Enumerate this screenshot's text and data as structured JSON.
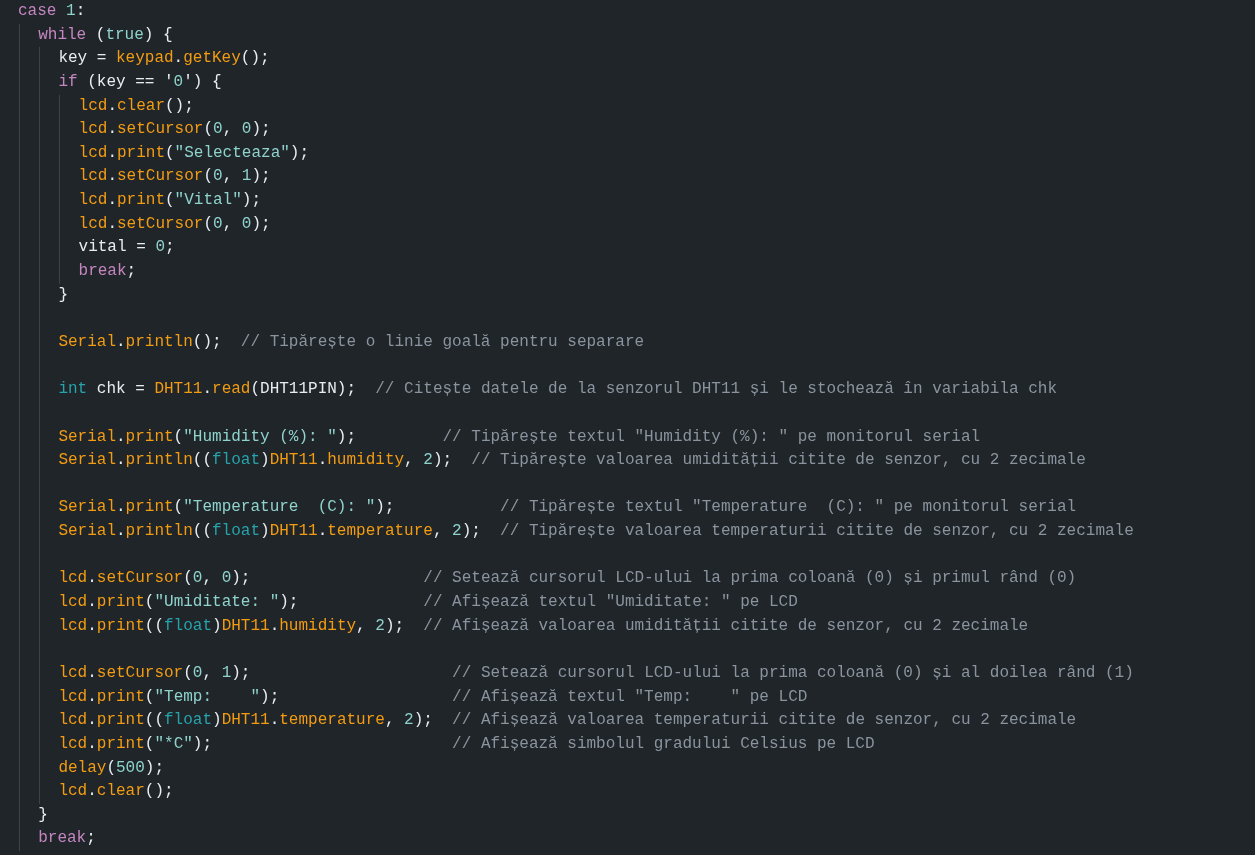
{
  "editor": {
    "lines": [
      {
        "kind": "code",
        "tokens": [
          {
            "text": "case ",
            "kind": "kw"
          },
          {
            "text": "1",
            "kind": "num"
          },
          {
            "text": ":",
            "kind": "plain"
          }
        ],
        "children": [
          {
            "kind": "code",
            "tokens": [
              {
                "text": "while ",
                "kind": "kw"
              },
              {
                "text": "(",
                "kind": "plain"
              },
              {
                "text": "true",
                "kind": "num"
              },
              {
                "text": ") {",
                "kind": "plain"
              }
            ],
            "children": [
              {
                "kind": "code",
                "tokens": [
                  {
                    "text": "key = ",
                    "kind": "plain"
                  },
                  {
                    "text": "keypad",
                    "kind": "fn"
                  },
                  {
                    "text": ".",
                    "kind": "plain"
                  },
                  {
                    "text": "getKey",
                    "kind": "fn"
                  },
                  {
                    "text": "();",
                    "kind": "plain"
                  }
                ]
              },
              {
                "kind": "code",
                "tokens": [
                  {
                    "text": "if ",
                    "kind": "kw"
                  },
                  {
                    "text": "(key == '",
                    "kind": "plain"
                  },
                  {
                    "text": "0",
                    "kind": "num"
                  },
                  {
                    "text": "') {",
                    "kind": "plain"
                  }
                ],
                "children": [
                  {
                    "kind": "code",
                    "tokens": [
                      {
                        "text": "lcd",
                        "kind": "fn"
                      },
                      {
                        "text": ".",
                        "kind": "plain"
                      },
                      {
                        "text": "clear",
                        "kind": "fn"
                      },
                      {
                        "text": "();",
                        "kind": "plain"
                      }
                    ]
                  },
                  {
                    "kind": "code",
                    "tokens": [
                      {
                        "text": "lcd",
                        "kind": "fn"
                      },
                      {
                        "text": ".",
                        "kind": "plain"
                      },
                      {
                        "text": "setCursor",
                        "kind": "fn"
                      },
                      {
                        "text": "(",
                        "kind": "plain"
                      },
                      {
                        "text": "0",
                        "kind": "num"
                      },
                      {
                        "text": ", ",
                        "kind": "plain"
                      },
                      {
                        "text": "0",
                        "kind": "num"
                      },
                      {
                        "text": ");",
                        "kind": "plain"
                      }
                    ]
                  },
                  {
                    "kind": "code",
                    "tokens": [
                      {
                        "text": "lcd",
                        "kind": "fn"
                      },
                      {
                        "text": ".",
                        "kind": "plain"
                      },
                      {
                        "text": "print",
                        "kind": "fn"
                      },
                      {
                        "text": "(",
                        "kind": "plain"
                      },
                      {
                        "text": "\"Selecteaza\"",
                        "kind": "str"
                      },
                      {
                        "text": ");",
                        "kind": "plain"
                      }
                    ]
                  },
                  {
                    "kind": "code",
                    "tokens": [
                      {
                        "text": "lcd",
                        "kind": "fn"
                      },
                      {
                        "text": ".",
                        "kind": "plain"
                      },
                      {
                        "text": "setCursor",
                        "kind": "fn"
                      },
                      {
                        "text": "(",
                        "kind": "plain"
                      },
                      {
                        "text": "0",
                        "kind": "num"
                      },
                      {
                        "text": ", ",
                        "kind": "plain"
                      },
                      {
                        "text": "1",
                        "kind": "num"
                      },
                      {
                        "text": ");",
                        "kind": "plain"
                      }
                    ]
                  },
                  {
                    "kind": "code",
                    "tokens": [
                      {
                        "text": "lcd",
                        "kind": "fn"
                      },
                      {
                        "text": ".",
                        "kind": "plain"
                      },
                      {
                        "text": "print",
                        "kind": "fn"
                      },
                      {
                        "text": "(",
                        "kind": "plain"
                      },
                      {
                        "text": "\"Vital\"",
                        "kind": "str"
                      },
                      {
                        "text": ");",
                        "kind": "plain"
                      }
                    ]
                  },
                  {
                    "kind": "code",
                    "tokens": [
                      {
                        "text": "lcd",
                        "kind": "fn"
                      },
                      {
                        "text": ".",
                        "kind": "plain"
                      },
                      {
                        "text": "setCursor",
                        "kind": "fn"
                      },
                      {
                        "text": "(",
                        "kind": "plain"
                      },
                      {
                        "text": "0",
                        "kind": "num"
                      },
                      {
                        "text": ", ",
                        "kind": "plain"
                      },
                      {
                        "text": "0",
                        "kind": "num"
                      },
                      {
                        "text": ");",
                        "kind": "plain"
                      }
                    ]
                  },
                  {
                    "kind": "code",
                    "tokens": [
                      {
                        "text": "vital = ",
                        "kind": "plain"
                      },
                      {
                        "text": "0",
                        "kind": "num"
                      },
                      {
                        "text": ";",
                        "kind": "plain"
                      }
                    ]
                  },
                  {
                    "kind": "code",
                    "tokens": [
                      {
                        "text": "break",
                        "kind": "kw"
                      },
                      {
                        "text": ";",
                        "kind": "plain"
                      }
                    ]
                  }
                ]
              },
              {
                "kind": "code",
                "tokens": [
                  {
                    "text": "}",
                    "kind": "plain"
                  }
                ]
              },
              {
                "kind": "blank"
              },
              {
                "kind": "code",
                "tokens": [
                  {
                    "text": "Serial",
                    "kind": "fn"
                  },
                  {
                    "text": ".",
                    "kind": "plain"
                  },
                  {
                    "text": "println",
                    "kind": "fn"
                  },
                  {
                    "text": "();  ",
                    "kind": "plain"
                  },
                  {
                    "text": "// Tipărește o linie goală pentru separare",
                    "kind": "cmt"
                  }
                ]
              },
              {
                "kind": "blank"
              },
              {
                "kind": "code",
                "tokens": [
                  {
                    "text": "int",
                    "kind": "type"
                  },
                  {
                    "text": " chk = ",
                    "kind": "plain"
                  },
                  {
                    "text": "DHT11",
                    "kind": "fn"
                  },
                  {
                    "text": ".",
                    "kind": "plain"
                  },
                  {
                    "text": "read",
                    "kind": "fn"
                  },
                  {
                    "text": "(DHT11PIN);  ",
                    "kind": "plain"
                  },
                  {
                    "text": "// Citește datele de la senzorul DHT11 și le stochează în variabila chk",
                    "kind": "cmt"
                  }
                ]
              },
              {
                "kind": "blank"
              },
              {
                "kind": "code",
                "tokens": [
                  {
                    "text": "Serial",
                    "kind": "fn"
                  },
                  {
                    "text": ".",
                    "kind": "plain"
                  },
                  {
                    "text": "print",
                    "kind": "fn"
                  },
                  {
                    "text": "(",
                    "kind": "plain"
                  },
                  {
                    "text": "\"Humidity (%): \"",
                    "kind": "str"
                  },
                  {
                    "text": ");         ",
                    "kind": "plain"
                  },
                  {
                    "text": "// Tipărește textul \"Humidity (%): \" pe monitorul serial",
                    "kind": "cmt"
                  }
                ]
              },
              {
                "kind": "code",
                "tokens": [
                  {
                    "text": "Serial",
                    "kind": "fn"
                  },
                  {
                    "text": ".",
                    "kind": "plain"
                  },
                  {
                    "text": "println",
                    "kind": "fn"
                  },
                  {
                    "text": "((",
                    "kind": "plain"
                  },
                  {
                    "text": "float",
                    "kind": "type"
                  },
                  {
                    "text": ")",
                    "kind": "plain"
                  },
                  {
                    "text": "DHT11",
                    "kind": "fn"
                  },
                  {
                    "text": ".",
                    "kind": "plain"
                  },
                  {
                    "text": "humidity",
                    "kind": "fn"
                  },
                  {
                    "text": ", ",
                    "kind": "plain"
                  },
                  {
                    "text": "2",
                    "kind": "num"
                  },
                  {
                    "text": ");  ",
                    "kind": "plain"
                  },
                  {
                    "text": "// Tipărește valoarea umidității citite de senzor, cu 2 zecimale",
                    "kind": "cmt"
                  }
                ]
              },
              {
                "kind": "blank"
              },
              {
                "kind": "code",
                "tokens": [
                  {
                    "text": "Serial",
                    "kind": "fn"
                  },
                  {
                    "text": ".",
                    "kind": "plain"
                  },
                  {
                    "text": "print",
                    "kind": "fn"
                  },
                  {
                    "text": "(",
                    "kind": "plain"
                  },
                  {
                    "text": "\"Temperature  (C): \"",
                    "kind": "str"
                  },
                  {
                    "text": ");           ",
                    "kind": "plain"
                  },
                  {
                    "text": "// Tipărește textul \"Temperature  (C): \" pe monitorul serial",
                    "kind": "cmt"
                  }
                ]
              },
              {
                "kind": "code",
                "tokens": [
                  {
                    "text": "Serial",
                    "kind": "fn"
                  },
                  {
                    "text": ".",
                    "kind": "plain"
                  },
                  {
                    "text": "println",
                    "kind": "fn"
                  },
                  {
                    "text": "((",
                    "kind": "plain"
                  },
                  {
                    "text": "float",
                    "kind": "type"
                  },
                  {
                    "text": ")",
                    "kind": "plain"
                  },
                  {
                    "text": "DHT11",
                    "kind": "fn"
                  },
                  {
                    "text": ".",
                    "kind": "plain"
                  },
                  {
                    "text": "temperature",
                    "kind": "fn"
                  },
                  {
                    "text": ", ",
                    "kind": "plain"
                  },
                  {
                    "text": "2",
                    "kind": "num"
                  },
                  {
                    "text": ");  ",
                    "kind": "plain"
                  },
                  {
                    "text": "// Tipărește valoarea temperaturii citite de senzor, cu 2 zecimale",
                    "kind": "cmt"
                  }
                ]
              },
              {
                "kind": "blank"
              },
              {
                "kind": "code",
                "tokens": [
                  {
                    "text": "lcd",
                    "kind": "fn"
                  },
                  {
                    "text": ".",
                    "kind": "plain"
                  },
                  {
                    "text": "setCursor",
                    "kind": "fn"
                  },
                  {
                    "text": "(",
                    "kind": "plain"
                  },
                  {
                    "text": "0",
                    "kind": "num"
                  },
                  {
                    "text": ", ",
                    "kind": "plain"
                  },
                  {
                    "text": "0",
                    "kind": "num"
                  },
                  {
                    "text": ");                  ",
                    "kind": "plain"
                  },
                  {
                    "text": "// Setează cursorul LCD-ului la prima coloană (0) și primul rând (0)",
                    "kind": "cmt"
                  }
                ]
              },
              {
                "kind": "code",
                "tokens": [
                  {
                    "text": "lcd",
                    "kind": "fn"
                  },
                  {
                    "text": ".",
                    "kind": "plain"
                  },
                  {
                    "text": "print",
                    "kind": "fn"
                  },
                  {
                    "text": "(",
                    "kind": "plain"
                  },
                  {
                    "text": "\"Umiditate: \"",
                    "kind": "str"
                  },
                  {
                    "text": ");             ",
                    "kind": "plain"
                  },
                  {
                    "text": "// Afișează textul \"Umiditate: \" pe LCD",
                    "kind": "cmt"
                  }
                ]
              },
              {
                "kind": "code",
                "tokens": [
                  {
                    "text": "lcd",
                    "kind": "fn"
                  },
                  {
                    "text": ".",
                    "kind": "plain"
                  },
                  {
                    "text": "print",
                    "kind": "fn"
                  },
                  {
                    "text": "((",
                    "kind": "plain"
                  },
                  {
                    "text": "float",
                    "kind": "type"
                  },
                  {
                    "text": ")",
                    "kind": "plain"
                  },
                  {
                    "text": "DHT11",
                    "kind": "fn"
                  },
                  {
                    "text": ".",
                    "kind": "plain"
                  },
                  {
                    "text": "humidity",
                    "kind": "fn"
                  },
                  {
                    "text": ", ",
                    "kind": "plain"
                  },
                  {
                    "text": "2",
                    "kind": "num"
                  },
                  {
                    "text": ");  ",
                    "kind": "plain"
                  },
                  {
                    "text": "// Afișează valoarea umidității citite de senzor, cu 2 zecimale",
                    "kind": "cmt"
                  }
                ]
              },
              {
                "kind": "blank"
              },
              {
                "kind": "code",
                "tokens": [
                  {
                    "text": "lcd",
                    "kind": "fn"
                  },
                  {
                    "text": ".",
                    "kind": "plain"
                  },
                  {
                    "text": "setCursor",
                    "kind": "fn"
                  },
                  {
                    "text": "(",
                    "kind": "plain"
                  },
                  {
                    "text": "0",
                    "kind": "num"
                  },
                  {
                    "text": ", ",
                    "kind": "plain"
                  },
                  {
                    "text": "1",
                    "kind": "num"
                  },
                  {
                    "text": ");                     ",
                    "kind": "plain"
                  },
                  {
                    "text": "// Setează cursorul LCD-ului la prima coloană (0) și al doilea rând (1)",
                    "kind": "cmt"
                  }
                ]
              },
              {
                "kind": "code",
                "tokens": [
                  {
                    "text": "lcd",
                    "kind": "fn"
                  },
                  {
                    "text": ".",
                    "kind": "plain"
                  },
                  {
                    "text": "print",
                    "kind": "fn"
                  },
                  {
                    "text": "(",
                    "kind": "plain"
                  },
                  {
                    "text": "\"Temp:    \"",
                    "kind": "str"
                  },
                  {
                    "text": ");                  ",
                    "kind": "plain"
                  },
                  {
                    "text": "// Afișează textul \"Temp:    \" pe LCD",
                    "kind": "cmt"
                  }
                ]
              },
              {
                "kind": "code",
                "tokens": [
                  {
                    "text": "lcd",
                    "kind": "fn"
                  },
                  {
                    "text": ".",
                    "kind": "plain"
                  },
                  {
                    "text": "print",
                    "kind": "fn"
                  },
                  {
                    "text": "((",
                    "kind": "plain"
                  },
                  {
                    "text": "float",
                    "kind": "type"
                  },
                  {
                    "text": ")",
                    "kind": "plain"
                  },
                  {
                    "text": "DHT11",
                    "kind": "fn"
                  },
                  {
                    "text": ".",
                    "kind": "plain"
                  },
                  {
                    "text": "temperature",
                    "kind": "fn"
                  },
                  {
                    "text": ", ",
                    "kind": "plain"
                  },
                  {
                    "text": "2",
                    "kind": "num"
                  },
                  {
                    "text": ");  ",
                    "kind": "plain"
                  },
                  {
                    "text": "// Afișează valoarea temperaturii citite de senzor, cu 2 zecimale",
                    "kind": "cmt"
                  }
                ]
              },
              {
                "kind": "code",
                "tokens": [
                  {
                    "text": "lcd",
                    "kind": "fn"
                  },
                  {
                    "text": ".",
                    "kind": "plain"
                  },
                  {
                    "text": "print",
                    "kind": "fn"
                  },
                  {
                    "text": "(",
                    "kind": "plain"
                  },
                  {
                    "text": "\"*C\"",
                    "kind": "str"
                  },
                  {
                    "text": ");                         ",
                    "kind": "plain"
                  },
                  {
                    "text": "// Afișează simbolul gradului Celsius pe LCD",
                    "kind": "cmt"
                  }
                ]
              },
              {
                "kind": "code",
                "tokens": [
                  {
                    "text": "delay",
                    "kind": "fn"
                  },
                  {
                    "text": "(",
                    "kind": "plain"
                  },
                  {
                    "text": "500",
                    "kind": "num"
                  },
                  {
                    "text": ");",
                    "kind": "plain"
                  }
                ]
              },
              {
                "kind": "code",
                "tokens": [
                  {
                    "text": "lcd",
                    "kind": "fn"
                  },
                  {
                    "text": ".",
                    "kind": "plain"
                  },
                  {
                    "text": "clear",
                    "kind": "fn"
                  },
                  {
                    "text": "();",
                    "kind": "plain"
                  }
                ]
              }
            ]
          },
          {
            "kind": "code",
            "tokens": [
              {
                "text": "}",
                "kind": "plain"
              }
            ]
          },
          {
            "kind": "code",
            "tokens": [
              {
                "text": "break",
                "kind": "kw"
              },
              {
                "text": ";",
                "kind": "plain"
              }
            ]
          }
        ]
      }
    ]
  }
}
